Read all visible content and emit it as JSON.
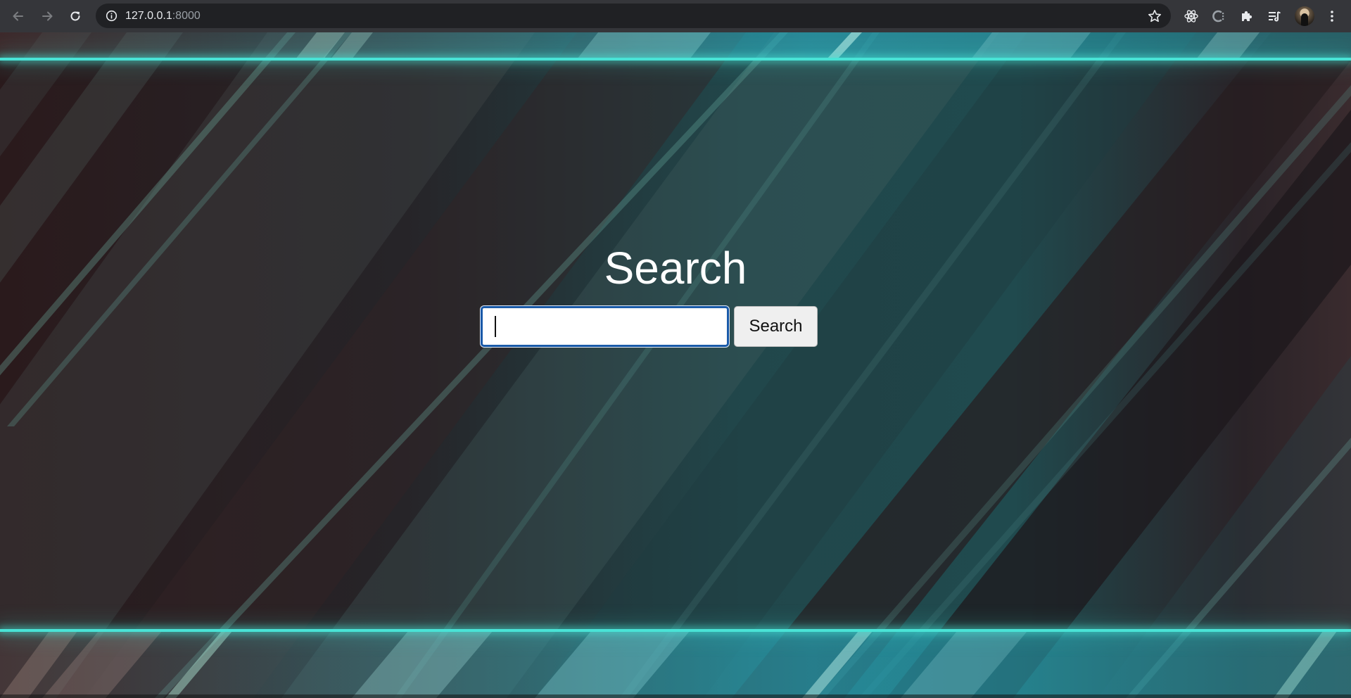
{
  "browser": {
    "url_host": "127.0.0.1",
    "url_port": ":8000",
    "back_icon": "arrow-left-icon",
    "forward_icon": "arrow-right-icon",
    "reload_icon": "reload-icon",
    "info_icon": "info-icon",
    "bookmark_icon": "star-icon",
    "extensions": [
      "react-devtools-icon",
      "c-extension-icon",
      "puzzle-icon",
      "reading-list-icon"
    ],
    "menu_icon": "kebab-menu-icon"
  },
  "page": {
    "title": "Search",
    "search_input_value": "",
    "search_input_placeholder": "",
    "search_button_label": "Search"
  },
  "colors": {
    "accent_glow": "#49e3d6",
    "input_focus_border": "#1a5aa8",
    "title_text": "#ffffff",
    "chrome_bg": "#35363a",
    "omnibox_bg": "#202124"
  }
}
